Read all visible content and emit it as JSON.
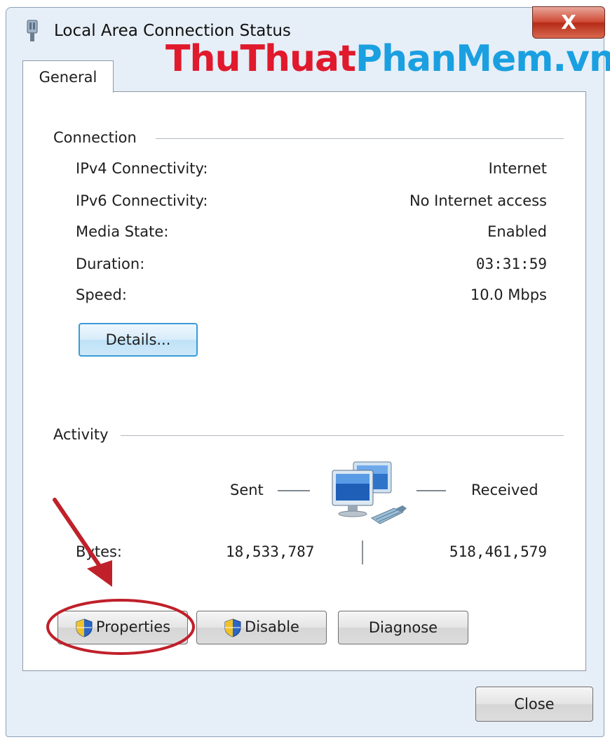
{
  "window": {
    "title": "Local Area Connection Status",
    "close_label": "X"
  },
  "watermark": {
    "part1": "ThuThuat",
    "part2": "PhanMem.vn",
    "color1": "#e0192c",
    "color2": "#1aa0e0"
  },
  "tabs": [
    {
      "label": "General",
      "selected": true
    }
  ],
  "connection": {
    "heading": "Connection",
    "rows": [
      {
        "label": "IPv4 Connectivity:",
        "value": "Internet"
      },
      {
        "label": "IPv6 Connectivity:",
        "value": "No Internet access"
      },
      {
        "label": "Media State:",
        "value": "Enabled"
      },
      {
        "label": "Duration:",
        "value": "03:31:59"
      },
      {
        "label": "Speed:",
        "value": "10.0 Mbps"
      }
    ],
    "details_button": "Details..."
  },
  "activity": {
    "heading": "Activity",
    "sent_label": "Sent",
    "received_label": "Received",
    "bytes_label": "Bytes:",
    "sent_bytes": "18,533,787",
    "received_bytes": "518,461,579",
    "icon": "network-computers-icon"
  },
  "buttons": {
    "properties": "Properties",
    "disable": "Disable",
    "diagnose": "Diagnose",
    "close": "Close"
  },
  "annotation": {
    "color": "#c0202a"
  }
}
